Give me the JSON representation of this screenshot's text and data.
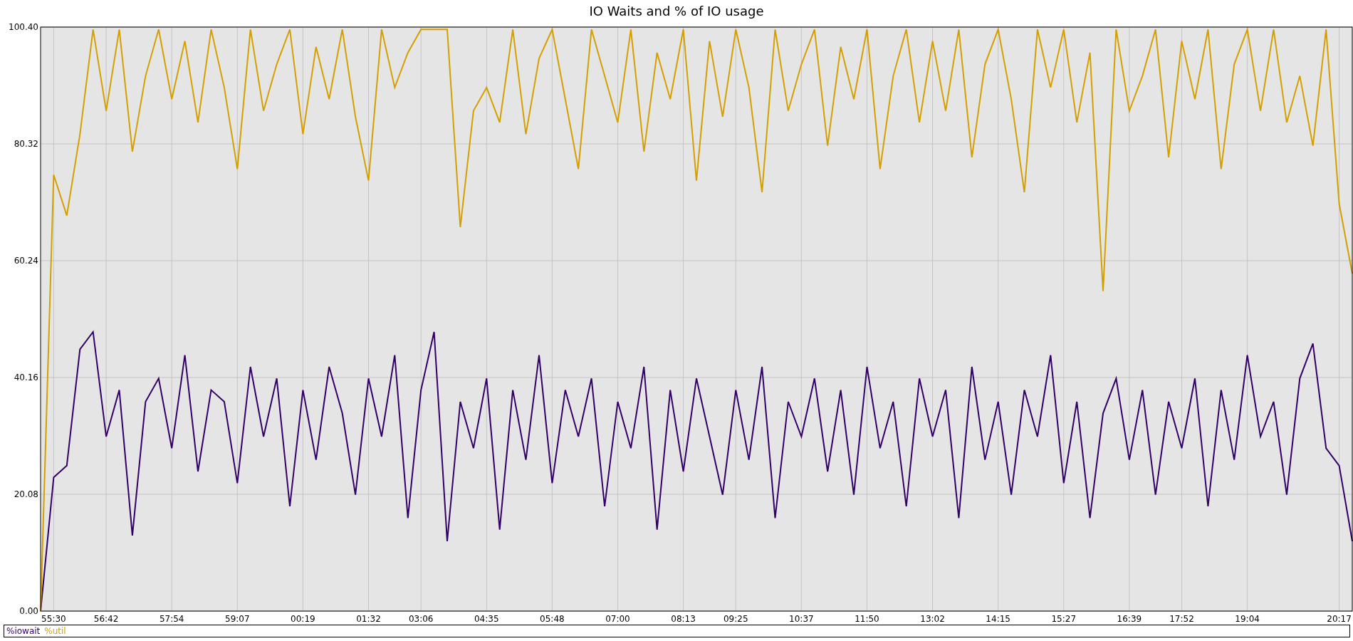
{
  "chart_data": {
    "type": "line",
    "title": "IO Waits and % of IO usage",
    "categories": [
      null,
      "55:30",
      null,
      null,
      null,
      "56:42",
      null,
      null,
      null,
      null,
      "57:54",
      null,
      null,
      null,
      null,
      "59:07",
      null,
      null,
      null,
      null,
      "00:19",
      null,
      null,
      null,
      null,
      "01:32",
      null,
      null,
      null,
      "03:06",
      null,
      null,
      null,
      null,
      "04:35",
      null,
      null,
      null,
      null,
      "05:48",
      null,
      null,
      null,
      null,
      "07:00",
      null,
      null,
      null,
      null,
      "08:13",
      null,
      null,
      null,
      "09:25",
      null,
      null,
      null,
      null,
      "10:37",
      null,
      null,
      null,
      null,
      "11:50",
      null,
      null,
      null,
      null,
      "13:02",
      null,
      null,
      null,
      null,
      "14:15",
      null,
      null,
      null,
      null,
      "15:27",
      null,
      null,
      null,
      null,
      "16:39",
      null,
      null,
      null,
      "17:52",
      null,
      null,
      null,
      null,
      "19:04",
      null,
      null,
      null,
      null,
      null,
      null,
      "20:17",
      null
    ],
    "series": [
      {
        "name": "%iowait",
        "color": "#330066",
        "values": [
          0,
          23,
          25,
          45,
          48,
          30,
          38,
          13,
          36,
          40,
          28,
          44,
          24,
          38,
          36,
          22,
          42,
          30,
          40,
          18,
          38,
          26,
          42,
          34,
          20,
          40,
          30,
          44,
          16,
          38,
          48,
          12,
          36,
          28,
          40,
          14,
          38,
          26,
          44,
          22,
          38,
          30,
          40,
          18,
          36,
          28,
          42,
          14,
          38,
          24,
          40,
          30,
          20,
          38,
          26,
          42,
          16,
          36,
          30,
          40,
          24,
          38,
          20,
          42,
          28,
          36,
          18,
          40,
          30,
          38,
          16,
          42,
          26,
          36,
          20,
          38,
          30,
          44,
          22,
          36,
          16,
          34,
          40,
          26,
          38,
          20,
          36,
          28,
          40,
          18,
          38,
          26,
          44,
          30,
          36,
          20,
          40,
          46,
          28,
          25,
          12
        ]
      },
      {
        "name": "%util",
        "color": "#d4a000",
        "values": [
          0,
          75,
          68,
          82,
          100,
          86,
          100,
          79,
          92,
          100,
          88,
          98,
          84,
          100,
          90,
          76,
          100,
          86,
          94,
          100,
          82,
          97,
          88,
          100,
          85,
          74,
          100,
          90,
          96,
          100,
          100,
          100,
          66,
          86,
          90,
          84,
          100,
          82,
          95,
          100,
          88,
          76,
          100,
          92,
          84,
          100,
          79,
          96,
          88,
          100,
          74,
          98,
          85,
          100,
          90,
          72,
          100,
          86,
          94,
          100,
          80,
          97,
          88,
          100,
          76,
          92,
          100,
          84,
          98,
          86,
          100,
          78,
          94,
          100,
          88,
          72,
          100,
          90,
          100,
          84,
          96,
          55,
          100,
          86,
          92,
          100,
          78,
          98,
          88,
          100,
          76,
          94,
          100,
          86,
          100,
          84,
          92,
          80,
          100,
          70,
          58
        ]
      }
    ],
    "ylim": [
      0,
      100.4
    ],
    "grid": true,
    "yticks": [
      {
        "value": 0,
        "label": "0.00"
      },
      {
        "value": 20.08,
        "label": "20.08"
      },
      {
        "value": 40.16,
        "label": "40.16"
      },
      {
        "value": 60.24,
        "label": "60.24"
      },
      {
        "value": 80.32,
        "label": "80.32"
      },
      {
        "value": 100.4,
        "label": "100.40"
      }
    ]
  }
}
